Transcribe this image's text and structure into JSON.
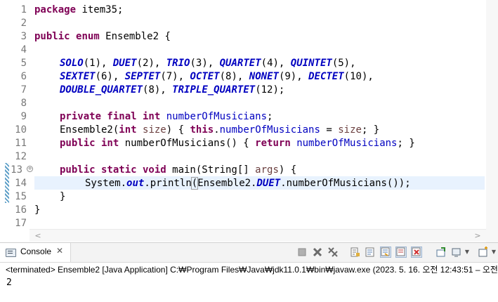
{
  "editor": {
    "line_numbers": [
      "1",
      "2",
      "3",
      "4",
      "5",
      "6",
      "7",
      "8",
      "9",
      "10",
      "11",
      "12",
      "13",
      "14",
      "15",
      "16",
      "17"
    ],
    "code": {
      "l1_kw": "package",
      "l1_rest": " item35;",
      "l3_kw1": "public",
      "l3_kw2": "enum",
      "l3_rest": " Ensemble2 {",
      "l5": [
        {
          "name": "SOLO",
          "args": "(1), "
        },
        {
          "name": "DUET",
          "args": "(2), "
        },
        {
          "name": "TRIO",
          "args": "(3), "
        },
        {
          "name": "QUARTET",
          "args": "(4), "
        },
        {
          "name": "QUINTET",
          "args": "(5),"
        }
      ],
      "l6": [
        {
          "name": "SEXTET",
          "args": "(6), "
        },
        {
          "name": "SEPTET",
          "args": "(7), "
        },
        {
          "name": "OCTET",
          "args": "(8), "
        },
        {
          "name": "NONET",
          "args": "(9), "
        },
        {
          "name": "DECTET",
          "args": "(10),"
        }
      ],
      "l7": [
        {
          "name": "DOUBLE_QUARTET",
          "args": "(8), "
        },
        {
          "name": "TRIPLE_QUARTET",
          "args": "(12);"
        }
      ],
      "l9_kw": "private final int",
      "l9_field": "numberOfMusicians",
      "l9_end": ";",
      "l10_a": "Ensemble2(",
      "l10_kw1": "int",
      "l10_param": " size",
      "l10_b": ") { ",
      "l10_kw2": "this",
      "l10_dot": ".",
      "l10_field": "numberOfMusicians",
      "l10_eq": " = ",
      "l10_param2": "size",
      "l10_end": "; }",
      "l11_kw": "public int",
      "l11_a": " numberOfMusicians() { ",
      "l11_kw2": "return",
      "l11_field": "numberOfMusicians",
      "l11_end": "; }",
      "l13_kw": "public static void",
      "l13_a": " main(String[] ",
      "l13_param": "args",
      "l13_end": ") {",
      "l14_a": "System.",
      "l14_out": "out",
      "l14_b": ".println",
      "l14_paren": "(",
      "l14_c": "Ensemble2.",
      "l14_duet": "DUET",
      "l14_d": ".numberOfMusicians());",
      "l15": "}",
      "l16": "}"
    },
    "fold_glyph": "⊖"
  },
  "console": {
    "tab_label": "Console",
    "tab_close": "✕",
    "status_line": "<terminated> Ensemble2 [Java Application] C:₩Program Files₩Java₩jdk11.0.1₩bin₩javaw.exe  (2023. 5. 16. 오전 12:43:51 – 오전",
    "output": "2",
    "toolbar_icons": [
      "terminate-icon",
      "remove-launch-icon",
      "remove-all-terminated-icon",
      "scroll-lock-icon",
      "word-wrap-icon",
      "show-on-stdout-icon",
      "show-on-stderr-icon",
      "pin-console-icon",
      "display-selected-console-icon",
      "open-console-icon"
    ]
  },
  "colors": {
    "keyword": "#7f0055",
    "field": "#0000c0",
    "parameter": "#6a3e3e",
    "current_line": "#e8f2fe"
  }
}
